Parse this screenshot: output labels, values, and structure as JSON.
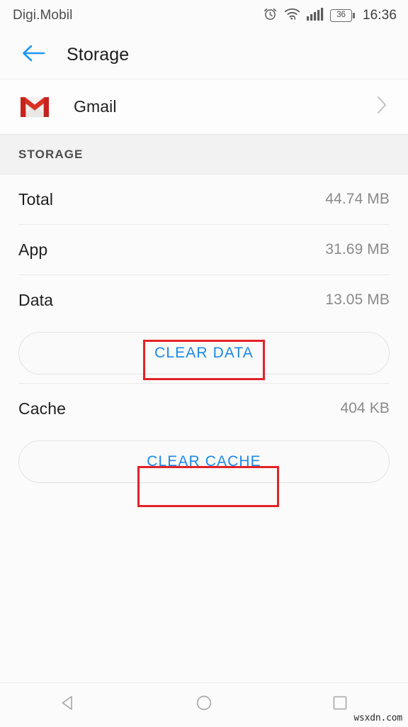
{
  "status_bar": {
    "carrier": "Digi.Mobil",
    "alarm_icon": "alarm-clock-icon",
    "wifi_icon": "wifi-icon",
    "signal_icon": "cellular-signal-icon",
    "battery_level": "36",
    "time": "16:36"
  },
  "app_bar": {
    "back_icon": "arrow-left-icon",
    "title": "Storage",
    "accent_color": "#2196f3"
  },
  "app_row": {
    "icon": "gmail-icon",
    "name": "Gmail",
    "chevron_icon": "chevron-right-icon"
  },
  "section": {
    "header": "STORAGE"
  },
  "storage": {
    "rows": [
      {
        "label": "Total",
        "value": "44.74 MB"
      },
      {
        "label": "App",
        "value": "31.69 MB"
      },
      {
        "label": "Data",
        "value": "13.05 MB"
      }
    ],
    "clear_data_label": "CLEAR DATA",
    "cache_row": {
      "label": "Cache",
      "value": "404 KB"
    },
    "clear_cache_label": "CLEAR CACHE",
    "button_text_color": "#1e88e5"
  },
  "annotations": {
    "color": "#e32227",
    "targets": [
      "clear-data-button",
      "clear-cache-button"
    ]
  },
  "nav_bar": {
    "back_icon": "triangle-back-icon",
    "home_icon": "circle-home-icon",
    "recents_icon": "square-recents-icon"
  },
  "watermark": "wsxdn.com"
}
